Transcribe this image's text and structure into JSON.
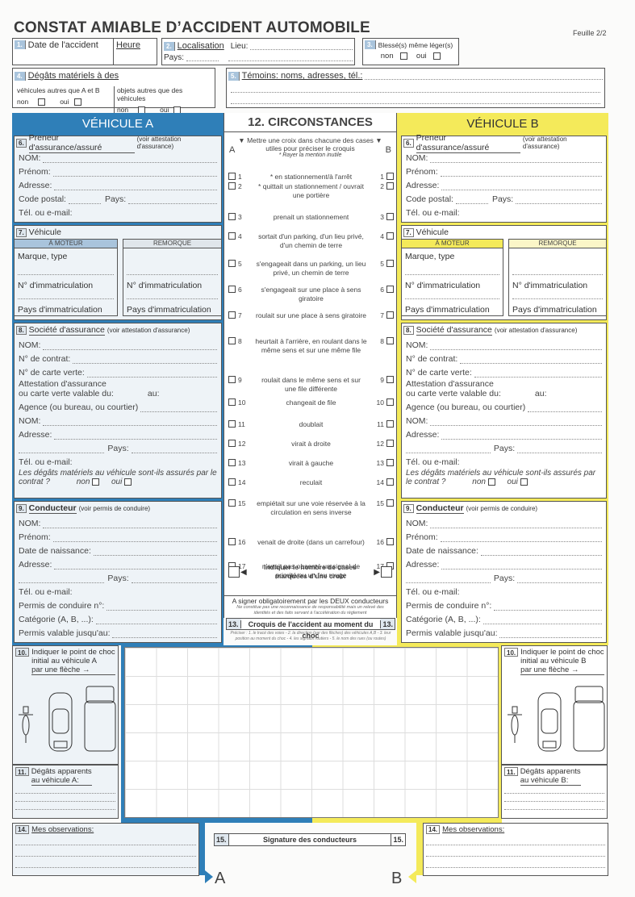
{
  "header": {
    "title": "CONSTAT AMIABLE D’ACCIDENT AUTOMOBILE",
    "sheet": "Feuille 2/2"
  },
  "colors": {
    "vehicle_a": "#2f7fb8",
    "vehicle_b": "#f4ea5a",
    "section_number": "#a9c4dc"
  },
  "s1": {
    "num": "1.",
    "date_label": "Date de l'accident",
    "time_label": "Heure"
  },
  "s2": {
    "num": "2.",
    "label": "Localisation",
    "place_label": "Lieu:",
    "country_label": "Pays:"
  },
  "s3": {
    "num": "3.",
    "label": "Blessé(s) même léger(s)",
    "no": "non",
    "yes": "oui"
  },
  "s4": {
    "num": "4.",
    "label": "Dégâts matériels à des",
    "vehicles_label": "véhicules autres que A et B",
    "objects_label": "objets autres que des véhicules",
    "no": "non",
    "yes": "oui"
  },
  "s5": {
    "num": "5.",
    "label": "Témoins: noms, adresses, tél.:"
  },
  "vehicle_a": {
    "title": "VÉHICULE A",
    "arrow_label": "A",
    "s6": {
      "num": "6.",
      "label": "Preneur d'assurance/assuré",
      "note": "(voir attestation d'assurance)",
      "fields": [
        "NOM:",
        "Prénom:",
        "Adresse:"
      ],
      "postal": "Code postal:",
      "country": "Pays:",
      "contact": "Tél. ou e-mail:"
    },
    "s7": {
      "num": "7.",
      "label": "Véhicule",
      "motor": "À MOTEUR",
      "trailer": "REMORQUE",
      "make": "Marque, type",
      "reg": "N° d'immatriculation",
      "reg_country": "Pays d'immatriculation"
    },
    "s8": {
      "num": "8.",
      "label": "Société d'assurance",
      "note": "(voir attestation d'assurance)",
      "name": "NOM:",
      "contract": "N° de contrat:",
      "green_card": "N° de carte verte:",
      "cert1": "Attestation d'assurance",
      "cert2": "ou carte verte valable du:",
      "to": "au:",
      "agency": "Agence (ou bureau, ou courtier)",
      "agency_name": "NOM:",
      "address": "Adresse:",
      "country": "Pays:",
      "contact": "Tél. ou e-mail:",
      "damage_q": "Les dégâts matériels au véhicule sont-ils assurés par le contrat ?",
      "no": "non",
      "yes": "oui"
    },
    "s9": {
      "num": "9.",
      "label": "Conducteur",
      "note": "(voir permis de conduire)",
      "name": "NOM:",
      "first": "Prénom:",
      "birth": "Date de naissance:",
      "address": "Adresse:",
      "country": "Pays:",
      "contact": "Tél. ou e-mail:",
      "licence": "Permis de conduire n°:",
      "category": "Catégorie (A, B, ...):",
      "valid": "Permis valable jusqu'au:"
    },
    "s10": {
      "num": "10.",
      "line1": "Indiquer le point de choc",
      "line2": "initial au véhicule A",
      "line3": "par une flèche →"
    },
    "s11": {
      "num": "11.",
      "line1": "Dégâts apparents",
      "line2": "au véhicule A:"
    },
    "s14": {
      "num": "14.",
      "label": "Mes observations:"
    }
  },
  "vehicle_b": {
    "title": "VÉHICULE B",
    "arrow_label": "B",
    "s6": {
      "num": "6.",
      "label": "Preneur d'assurance/assuré",
      "note": "(voir attestation d'assurance)",
      "fields": [
        "NOM:",
        "Prénom:",
        "Adresse:"
      ],
      "postal": "Code postal:",
      "country": "Pays:",
      "contact": "Tél. ou e-mail:"
    },
    "s7": {
      "num": "7.",
      "label": "Véhicule",
      "motor": "À MOTEUR",
      "trailer": "REMORQUE",
      "make": "Marque, type",
      "reg": "N° d'immatriculation",
      "reg_country": "Pays d'immatriculation"
    },
    "s8": {
      "num": "8.",
      "label": "Société d'assurance",
      "note": "(voir attestation d'assurance)",
      "name": "NOM:",
      "contract": "N° de contrat:",
      "green_card": "N° de carte verte:",
      "cert1": "Attestation d'assurance",
      "cert2": "ou carte verte valable du:",
      "to": "au:",
      "agency": "Agence (ou bureau, ou courtier)",
      "agency_name": "NOM:",
      "address": "Adresse:",
      "country": "Pays:",
      "contact": "Tél. ou e-mail:",
      "damage_q": "Les dégâts matériels au véhicule sont-ils assurés par le contrat ?",
      "no": "non",
      "yes": "oui"
    },
    "s9": {
      "num": "9.",
      "label": "Conducteur",
      "note": "(voir permis de conduire)",
      "name": "NOM:",
      "first": "Prénom:",
      "birth": "Date de naissance:",
      "address": "Adresse:",
      "country": "Pays:",
      "contact": "Tél. ou e-mail:",
      "licence": "Permis de conduire n°:",
      "category": "Catégorie (A, B, ...):",
      "valid": "Permis valable jusqu'au:"
    },
    "s10": {
      "num": "10.",
      "line1": "Indiquer le point de choc",
      "line2": "initial au véhicule B",
      "line3": "par une flèche →"
    },
    "s11": {
      "num": "11.",
      "line1": "Dégâts apparents",
      "line2": "au véhicule B:"
    },
    "s14": {
      "num": "14.",
      "label": "Mes observations:"
    }
  },
  "s12": {
    "title": "12. CIRCONSTANCES",
    "instr1": "Mettre une croix dans chacune des cases",
    "instr2": "utiles pour préciser le croquis",
    "instr3": "* Rayer la mention inutile",
    "col_a": "A",
    "col_b": "B",
    "items": [
      {
        "n": "1",
        "text": "* en stationnement/à l'arrêt"
      },
      {
        "n": "2",
        "text": "* quittait un stationnement / ouvrait une portière"
      },
      {
        "n": "3",
        "text": "prenait un stationnement"
      },
      {
        "n": "4",
        "text": "sortait d'un parking, d'un lieu privé, d'un chemin de terre"
      },
      {
        "n": "5",
        "text": "s'engageait dans un parking, un lieu privé, un chemin de terre"
      },
      {
        "n": "6",
        "text": "s'engageait sur une place à sens giratoire"
      },
      {
        "n": "7",
        "text": "roulait sur une place à sens giratoire"
      },
      {
        "n": "8",
        "text": "heurtait à l'arrière, en roulant dans le même sens et sur une même file"
      },
      {
        "n": "9",
        "text": "roulait dans le même sens et sur une file différente"
      },
      {
        "n": "10",
        "text": "changeait de file"
      },
      {
        "n": "11",
        "text": "doublait"
      },
      {
        "n": "12",
        "text": "virait à droite"
      },
      {
        "n": "13",
        "text": "virait à gauche"
      },
      {
        "n": "14",
        "text": "reculait"
      },
      {
        "n": "15",
        "text": "empiétait sur une voie réservée à la circulation en sens inverse"
      },
      {
        "n": "16",
        "text": "venait de droite (dans un carrefour)"
      },
      {
        "n": "17",
        "text": "n'avait pas observé un signal de priorité ou un feu rouge"
      }
    ],
    "count_label": "Indiquer le nombre de cases marquées d'une croix",
    "sign_note": "A signer obligatoirement par les DEUX conducteurs",
    "sign_sub": "Ne constitue pas une reconnaissance de responsabilité mais un relevé des identités et des faits servant à l'accélération du règlement"
  },
  "s13": {
    "num": "13.",
    "label": "Croquis de l'accident au moment du choc",
    "note": "Préciser : 1. le tracé des voies - 2. la direction (par des flèches) des véhicules A,B - 3. leur position au moment du choc - 4. les signaux routiers - 5. le nom des rues (ou routes)"
  },
  "s15": {
    "num": "15.",
    "label": "Signature des conducteurs"
  }
}
